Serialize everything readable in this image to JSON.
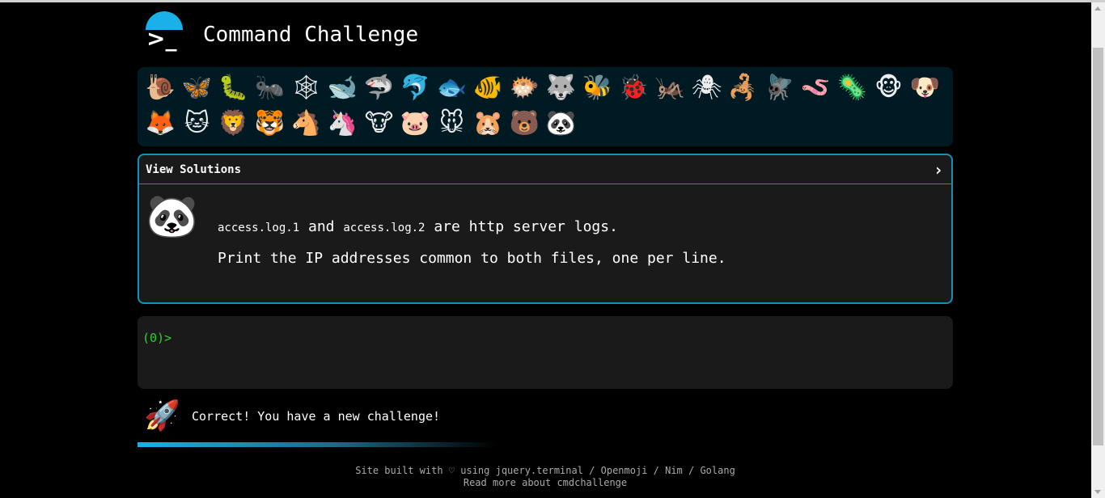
{
  "header": {
    "logo_prompt": ">_",
    "title": "Command Challenge"
  },
  "animals": [
    {
      "icon": "snail-icon",
      "glyph": "🐌"
    },
    {
      "icon": "butterfly-icon",
      "glyph": "🦋"
    },
    {
      "icon": "caterpillar-icon",
      "glyph": "🐛"
    },
    {
      "icon": "ant-icon",
      "glyph": "🐜"
    },
    {
      "icon": "spider-web-icon",
      "glyph": "🕸"
    },
    {
      "icon": "whale-icon",
      "glyph": "🐋"
    },
    {
      "icon": "shark-icon",
      "glyph": "🦈"
    },
    {
      "icon": "dolphin-icon",
      "glyph": "🐬"
    },
    {
      "icon": "fish-icon",
      "glyph": "🐟"
    },
    {
      "icon": "tropical-fish-icon",
      "glyph": "🐠"
    },
    {
      "icon": "blowfish-icon",
      "glyph": "🐡"
    },
    {
      "icon": "wolf-icon",
      "glyph": "🐺"
    },
    {
      "icon": "bee-icon",
      "glyph": "🐝"
    },
    {
      "icon": "lady-beetle-icon",
      "glyph": "🐞"
    },
    {
      "icon": "cricket-icon",
      "glyph": "🦗"
    },
    {
      "icon": "spider-icon",
      "glyph": "🕷"
    },
    {
      "icon": "scorpion-icon",
      "glyph": "🦂"
    },
    {
      "icon": "fly-icon",
      "glyph": "🪰"
    },
    {
      "icon": "worm-icon",
      "glyph": "🪱"
    },
    {
      "icon": "microbe-icon",
      "glyph": "🦠"
    },
    {
      "icon": "chimpanzee-icon",
      "glyph": "🐵"
    },
    {
      "icon": "dog-icon",
      "glyph": "🐶"
    },
    {
      "icon": "fox-icon",
      "glyph": "🦊"
    },
    {
      "icon": "cat-icon",
      "glyph": "🐱"
    },
    {
      "icon": "lion-icon",
      "glyph": "🦁"
    },
    {
      "icon": "tiger-icon",
      "glyph": "🐯"
    },
    {
      "icon": "horse-icon",
      "glyph": "🐴"
    },
    {
      "icon": "unicorn-icon",
      "glyph": "🦄"
    },
    {
      "icon": "cow-icon",
      "glyph": "🐮"
    },
    {
      "icon": "pig-icon",
      "glyph": "🐷"
    },
    {
      "icon": "mouse-icon",
      "glyph": "🐭"
    },
    {
      "icon": "hamster-icon",
      "glyph": "🐹"
    },
    {
      "icon": "bear-icon",
      "glyph": "🐻"
    },
    {
      "icon": "panda-icon",
      "glyph": "🐼",
      "active": true
    }
  ],
  "challenge": {
    "view_solutions_label": "View Solutions",
    "avatar_icon": "panda-icon",
    "avatar_glyph": "🐼",
    "file1": "access.log.1",
    "and_text": " and ",
    "file2": "access.log.2",
    "are_text": " are http server logs.",
    "instruction": "Print the IP addresses common to both files, one per line."
  },
  "terminal": {
    "prompt_code": "(0)",
    "prompt_symbol": ">"
  },
  "result": {
    "icon": "rocket-icon",
    "glyph": "🚀",
    "message": "Correct! You have a new challenge!"
  },
  "progress": {
    "fraction": 0.44
  },
  "footer": {
    "line1_prefix": "Site built with ",
    "heart": "♡",
    "line1_suffix": " using jquery.terminal / Openmoji / Nim / Golang",
    "line2": "Read more about cmdchallenge"
  },
  "colors": {
    "accent": "#1ab0e8",
    "border": "#1690b8",
    "prompt_green": "#33cc33",
    "panel_bg": "#1a1a1a",
    "animals_bg": "#001a24"
  }
}
